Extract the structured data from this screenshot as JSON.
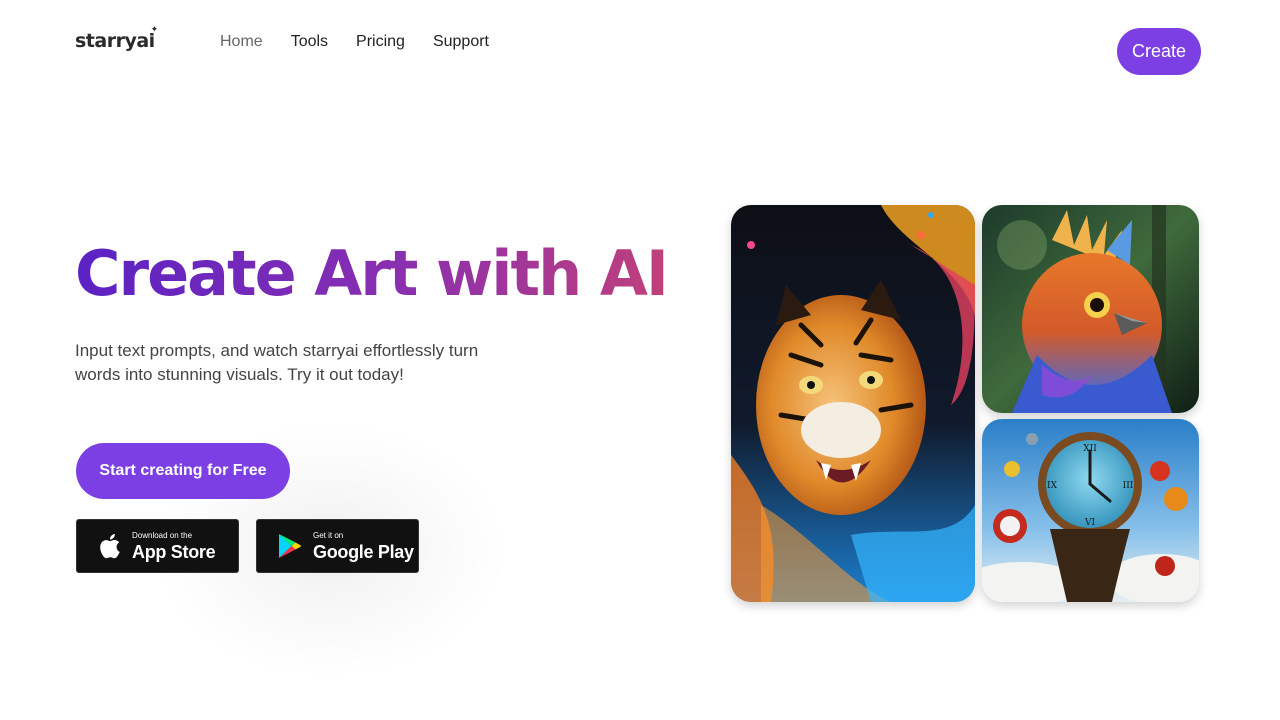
{
  "header": {
    "logo": "starryai",
    "nav": [
      {
        "label": "Home"
      },
      {
        "label": "Tools"
      },
      {
        "label": "Pricing"
      },
      {
        "label": "Support"
      }
    ],
    "create_label": "Create"
  },
  "hero": {
    "title": "Create Art with AI",
    "subtitle": "Input text prompts, and watch starryai effortlessly turn words into stunning visuals. Try it out today!",
    "cta_label": "Start creating for Free",
    "app_store": {
      "small": "Download on the",
      "big": "App Store"
    },
    "google_play": {
      "small": "Get it on",
      "big": "Google Play"
    }
  },
  "colors": {
    "accent": "#7b3fe4",
    "title_gradient": [
      "#5a22c4",
      "#8a2fb0",
      "#c0407a"
    ]
  },
  "gallery": [
    {
      "icon": "tiger-artwork"
    },
    {
      "icon": "bird-artwork"
    },
    {
      "icon": "melting-clock-artwork"
    }
  ]
}
